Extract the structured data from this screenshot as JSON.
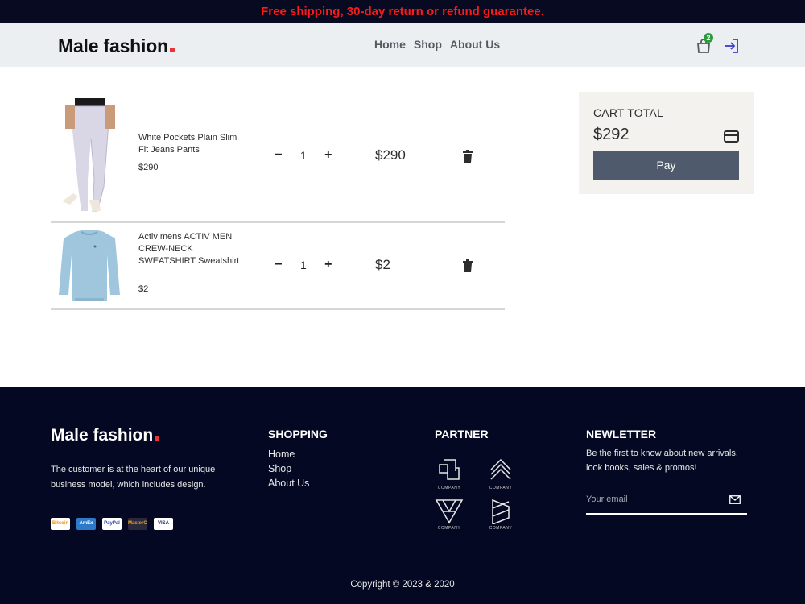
{
  "announcement": "Free shipping, 30-day return or refund guarantee.",
  "header": {
    "logo_text": "Male fashion",
    "nav": [
      "Home",
      "Shop",
      "About Us"
    ],
    "cart_count": "2"
  },
  "cart": {
    "items": [
      {
        "name": "White Pockets Plain Slim Fit Jeans Pants",
        "price": "$290",
        "quantity": "1",
        "total": "$290"
      },
      {
        "name": "Activ mens ACTIV MEN CREW-NECK SWEATSHIRT Sweatshirt",
        "price": "$2",
        "quantity": "1",
        "total": "$2"
      }
    ],
    "minus_label": "−",
    "plus_label": "+",
    "total_label": "CART TOTAL",
    "total_amount": "$292",
    "pay_label": "Pay"
  },
  "footer": {
    "logo_text": "Male fashion",
    "description": "The customer is at the heart of our unique business model, which includes design.",
    "payment_methods": [
      "Bitcoin",
      "AmEx",
      "PayPal",
      "MasterCard",
      "VISA"
    ],
    "shopping_title": "SHOPPING",
    "shopping_links": [
      "Home",
      "Shop",
      "About Us"
    ],
    "partner_title": "PARTNER",
    "partner_caption": "COMPANY",
    "newsletter_title": "NEWLETTER",
    "newsletter_text": "Be the first to know about new arrivals, look books, sales & promos!",
    "email_placeholder": "Your email",
    "copyright": "Copyright © 2023 & 2020"
  },
  "colors": {
    "brand_red": "#e53637",
    "footer_bg": "#050822",
    "pay_button": "#4f5a6d",
    "announcement_text": "#ff1a1a"
  }
}
